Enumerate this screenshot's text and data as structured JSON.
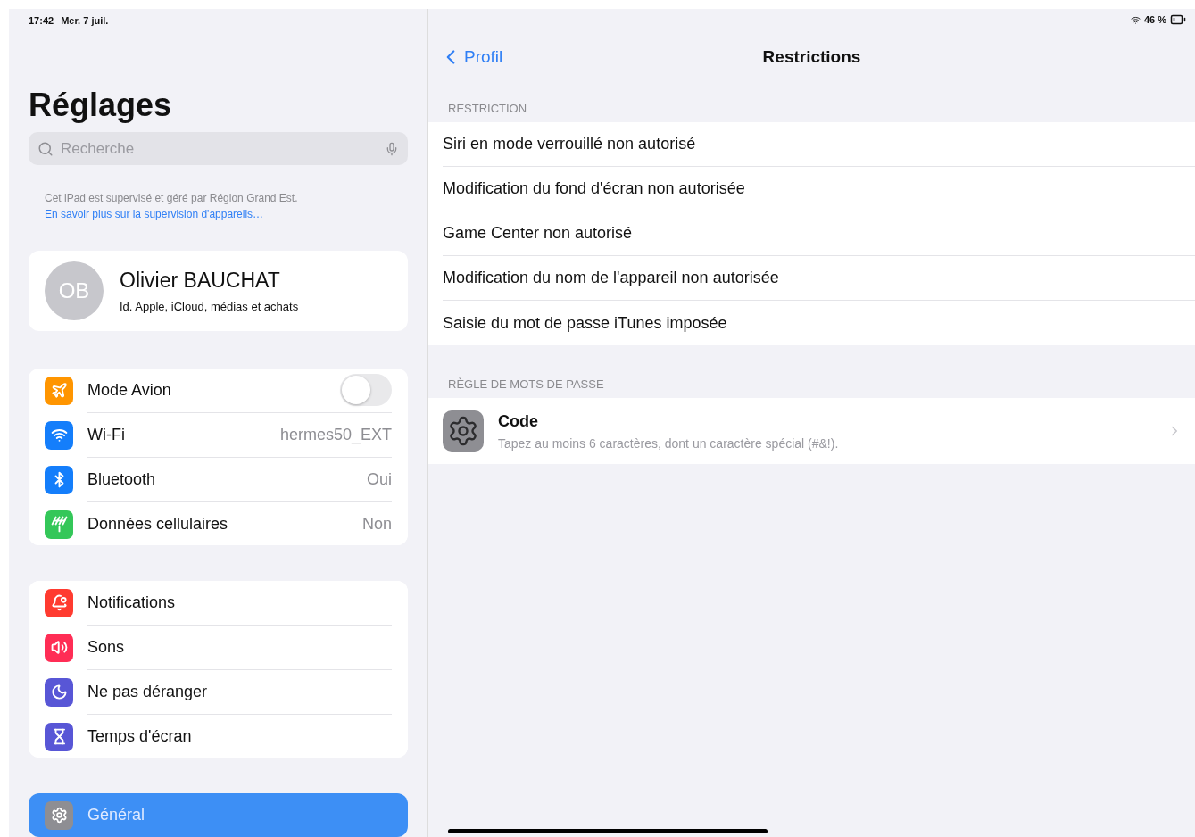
{
  "status_bar": {
    "time": "17:42",
    "date": "Mer. 7 juil.",
    "battery": "46 %"
  },
  "sidebar": {
    "title": "Réglages",
    "search": {
      "placeholder": "Recherche"
    },
    "supervision_note": {
      "text": "Cet iPad est supervisé et géré par Région Grand Est.",
      "link": "En savoir plus sur la supervision d'appareils…"
    },
    "profile": {
      "initials": "OB",
      "name": "Olivier BAUCHAT",
      "subtitle": "Id. Apple, iCloud, médias et achats"
    },
    "groups": [
      {
        "items": [
          {
            "kind": "toggle",
            "color": "#ff9500",
            "label": "Mode Avion",
            "on": false,
            "selected": false
          },
          {
            "kind": "value",
            "color": "#147efb",
            "label": "Wi-Fi",
            "value": "hermes50_EXT",
            "selected": false
          },
          {
            "kind": "value",
            "color": "#147efb",
            "label": "Bluetooth",
            "value": "Oui",
            "selected": false
          },
          {
            "kind": "value",
            "color": "#34c759",
            "label": "Données cellulaires",
            "value": "Non",
            "selected": false
          }
        ]
      },
      {
        "items": [
          {
            "kind": "plain",
            "color": "#ff3b30",
            "label": "Notifications",
            "selected": false
          },
          {
            "kind": "plain",
            "color": "#ff2d55",
            "label": "Sons",
            "selected": false
          },
          {
            "kind": "plain",
            "color": "#5856d6",
            "label": "Ne pas déranger",
            "selected": false
          },
          {
            "kind": "plain",
            "color": "#5856d6",
            "label": "Temps d'écran",
            "selected": false
          }
        ]
      },
      {
        "items": [
          {
            "kind": "plain",
            "color": "#8e8e93",
            "label": "Général",
            "selected": true
          }
        ]
      }
    ]
  },
  "detail": {
    "back": "Profil",
    "title": "Restrictions",
    "sections": [
      {
        "header": "RESTRICTION",
        "rows": [
          {
            "label": "Siri en mode verrouillé non autorisé"
          },
          {
            "label": "Modification du fond d'écran non autorisée"
          },
          {
            "label": "Game Center non autorisé"
          },
          {
            "label": "Modification du nom de l'appareil non autorisée"
          },
          {
            "label": "Saisie du mot de passe iTunes imposée"
          }
        ]
      },
      {
        "header": "RÈGLE DE MOTS DE PASSE",
        "rows": [
          {
            "label": "Code",
            "subtitle": "Tapez au moins 6 caractères, dont un caractère spécial (#&!)."
          }
        ]
      }
    ]
  }
}
